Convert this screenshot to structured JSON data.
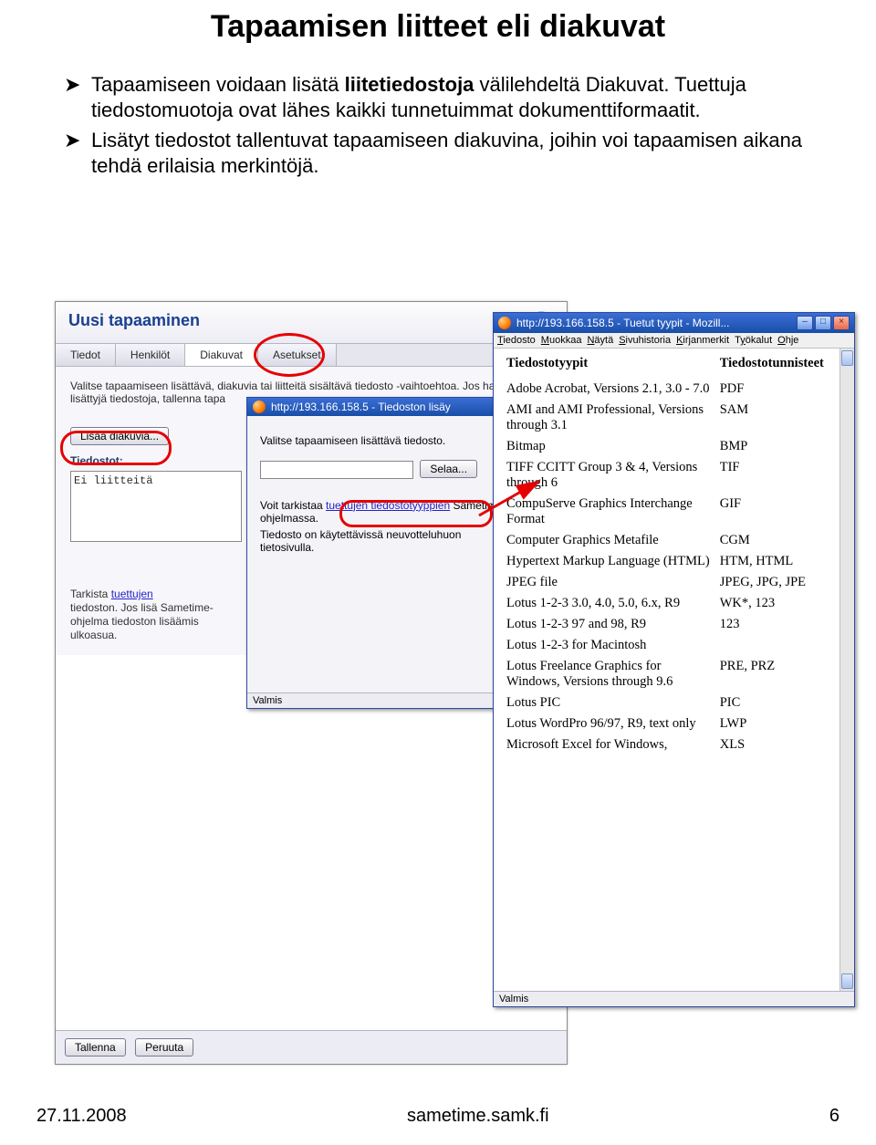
{
  "page_title": "Tapaamisen liitteet eli diakuvat",
  "bullets": [
    {
      "pre": "Tapaamiseen voidaan lisätä ",
      "bold": "liitetiedostoja",
      "post": " välilehdeltä Diakuvat. Tuettuja tiedostomuotoja ovat lähes kaikki tunnetuimmat dokumenttiformaatit."
    },
    {
      "pre": "Lisätyt tiedostot tallentuvat tapaamiseen diakuvina, joihin voi tapaamisen aikana tehdä erilaisia merkintöjä.",
      "bold": "",
      "post": ""
    }
  ],
  "footer": {
    "date": "27.11.2008",
    "center": "sametime.samk.fi",
    "page": "6"
  },
  "mainwin": {
    "title": "Uusi tapaaminen",
    "tabs": [
      "Tiedot",
      "Henkilöt",
      "Diakuvat",
      "Asetukset"
    ],
    "active_tab": 2,
    "intro": "Valitse tapaamiseen lisättävä, diakuvia tai liitteitä sisältävä tiedosto -vaihtoehtoa. Jos haluat poistaa lisättyjä tiedostoja, tallenna tapa",
    "add_btn": "Lisää diakuvia...",
    "files_label": "Tiedostot:",
    "files_empty": "Ei liitteitä",
    "sidehelp": {
      "pre": "Tarkista ",
      "link": "tuettujen",
      "post": " tiedoston. Jos lisä Sametime-ohjelma tiedoston lisäämis ulkoasua."
    },
    "save_btn": "Tallenna",
    "cancel_btn": "Peruuta"
  },
  "popup1": {
    "title": "http://193.166.158.5 - Tiedoston lisäy",
    "line1": "Valitse tapaamiseen lisättävä tiedosto.",
    "input_value": "",
    "browse_btn": "Selaa...",
    "line2_pre": "Voit tarkistaa ",
    "line2_link": "tuettujen tiedostotyyppien",
    "line2_post": " Sametime-ohjelmassa.",
    "line3": "Tiedosto on käytettävissä neuvotteluhuon tietosivulla.",
    "status": "Valmis"
  },
  "popup2": {
    "title": "http://193.166.158.5 - Tuetut tyypit - Mozill...",
    "menus": [
      "Tiedosto",
      "Muokkaa",
      "Näytä",
      "Sivuhistoria",
      "Kirjanmerkit",
      "Työkalut",
      "Ohje"
    ],
    "col1": "Tiedostotyypit",
    "col2": "Tiedostotunnisteet",
    "rows": [
      [
        "Adobe Acrobat, Versions 2.1, 3.0 - 7.0",
        "PDF"
      ],
      [
        "AMI and AMI Professional, Versions through 3.1",
        "SAM"
      ],
      [
        "Bitmap",
        "BMP"
      ],
      [
        "TIFF CCITT Group 3 & 4, Versions through 6",
        "TIF"
      ],
      [
        "CompuServe Graphics Interchange Format",
        "GIF"
      ],
      [
        "Computer Graphics Metafile",
        "CGM"
      ],
      [
        "Hypertext Markup Language (HTML)",
        "HTM, HTML"
      ],
      [
        "JPEG file",
        "JPEG, JPG, JPE"
      ],
      [
        "Lotus 1-2-3 3.0, 4.0, 5.0, 6.x, R9",
        "WK*, 123"
      ],
      [
        "Lotus 1-2-3 97 and 98, R9",
        "123"
      ],
      [
        "Lotus 1-2-3 for Macintosh",
        ""
      ],
      [
        "Lotus Freelance Graphics for Windows, Versions through 9.6",
        "PRE, PRZ"
      ],
      [
        "Lotus PIC",
        "PIC"
      ],
      [
        "Lotus WordPro 96/97, R9, text only",
        "LWP"
      ],
      [
        "Microsoft Excel for Windows,",
        "XLS"
      ]
    ],
    "status": "Valmis"
  }
}
